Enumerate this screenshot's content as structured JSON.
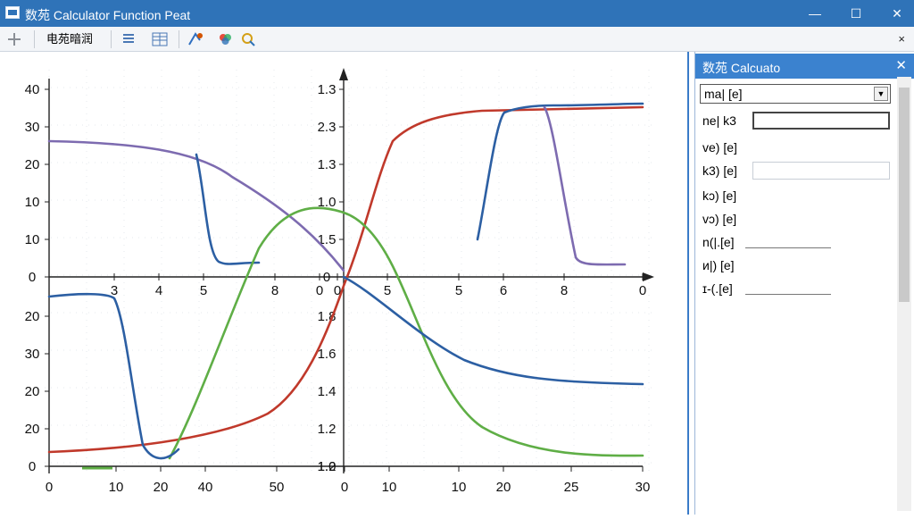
{
  "window": {
    "title": "数苑 Calculator Function Peat",
    "minimize_glyph": "—",
    "maximize_glyph": "☐",
    "close_glyph": "✕"
  },
  "toolbar": {
    "menu_label": "电苑暗润",
    "close_glyph": "×",
    "icons": [
      "cross-icon",
      "list-icon",
      "grid-icon",
      "cursor-edit-icon",
      "color-icon",
      "zoom-icon"
    ]
  },
  "panel": {
    "title": "数苑 Calcuato",
    "close_glyph": "✕",
    "dropdown_value": "ma| [e]",
    "rows": [
      {
        "label": "ne| k3",
        "value": ""
      },
      {
        "label": "ve) [e]",
        "value": ""
      },
      {
        "label": "k3) [e]",
        "value": ""
      },
      {
        "label": "kɔ) [e]",
        "value": ""
      },
      {
        "label": "vɔ) [e]",
        "value": ""
      },
      {
        "label": "n(|.[e]",
        "value": ""
      },
      {
        "label": "ᴎ|) [e]",
        "value": ""
      },
      {
        "label": "ɪ-(.[e]",
        "value": ""
      }
    ]
  },
  "chart_data": {
    "type": "line",
    "left_upper_y_ticks": [
      "40",
      "30",
      "20",
      "10",
      "10",
      "0"
    ],
    "left_lower_y_ticks": [
      "20",
      "30",
      "20",
      "20",
      "0"
    ],
    "right_upper_y_ticks": [
      "1.3",
      "2.3",
      "1.3",
      "1.0",
      "1.5",
      "0"
    ],
    "right_lower_y_ticks": [
      "1.8",
      "1.6",
      "1.4",
      "1.2",
      "1.2",
      "1.0"
    ],
    "middle_x_ticks": [
      "3",
      "4",
      "5",
      "8",
      "0",
      "0",
      "5",
      "5",
      "6",
      "8",
      "0"
    ],
    "bottom_x_ticks": [
      "0",
      "10",
      "20",
      "40",
      "50",
      "0",
      "10",
      "10",
      "20",
      "25",
      "30"
    ],
    "series": [
      {
        "color": "#2c5fa3",
        "points": [
          [
            0,
            25.5
          ],
          [
            40,
            25
          ],
          [
            80,
            24
          ],
          [
            120,
            22
          ],
          [
            160,
            19
          ],
          [
            165,
            16
          ],
          [
            175,
            6
          ],
          [
            185,
            2
          ],
          [
            200,
            1.5
          ]
        ]
      },
      {
        "color": "#c0392b",
        "points": [
          [
            0,
            -45
          ],
          [
            100,
            -42
          ],
          [
            200,
            -35
          ],
          [
            300,
            -20
          ],
          [
            350,
            -5
          ],
          [
            400,
            20
          ],
          [
            450,
            30
          ],
          [
            500,
            33
          ]
        ]
      },
      {
        "color": "#5fae46",
        "points": [
          [
            0,
            -50
          ],
          [
            100,
            -38
          ],
          [
            180,
            -5
          ],
          [
            240,
            18
          ],
          [
            300,
            15
          ],
          [
            350,
            -5
          ],
          [
            420,
            -40
          ],
          [
            500,
            -48
          ]
        ]
      }
    ],
    "colors": {
      "blue": "#2c5fa3",
      "red": "#c0392b",
      "green": "#5fae46",
      "purple": "#7d6bb0"
    }
  }
}
